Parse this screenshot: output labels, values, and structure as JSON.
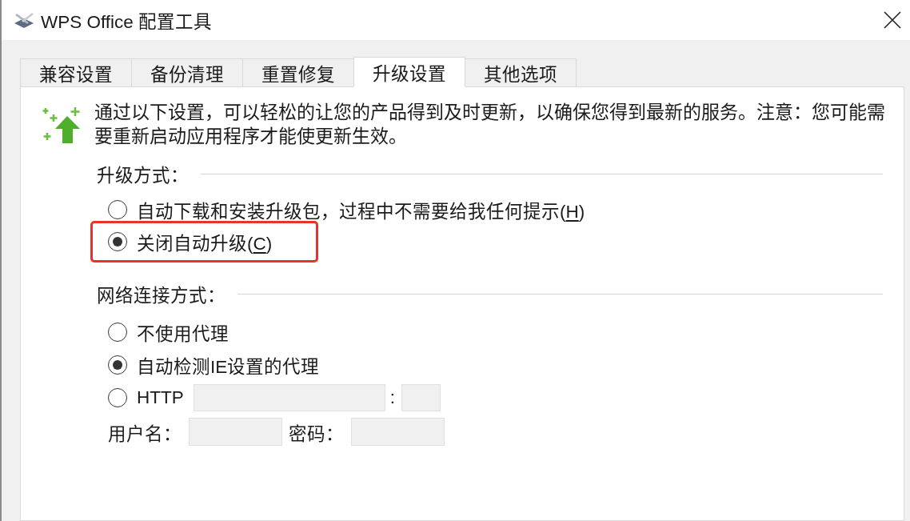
{
  "window": {
    "title": "WPS Office 配置工具"
  },
  "tabs": [
    {
      "label": "兼容设置",
      "selected": false
    },
    {
      "label": "备份清理",
      "selected": false
    },
    {
      "label": "重置修复",
      "selected": false
    },
    {
      "label": "升级设置",
      "selected": true
    },
    {
      "label": "其他选项",
      "selected": false
    }
  ],
  "intro": {
    "text": "通过以下设置，可以轻松的让您的产品得到及时更新，以确保您得到最新的服务。注意：您可能需要重新启动应用程序才能使更新生效。"
  },
  "upgrade_mode": {
    "label": "升级方式：",
    "options": [
      {
        "label_parts": [
          {
            "text": "自动下载和安装升级包，过程中不需要给我任何提示(",
            "underline": false
          },
          {
            "text": "H",
            "underline": true
          },
          {
            "text": ")",
            "underline": false
          }
        ],
        "selected": false,
        "highlighted": false
      },
      {
        "label_parts": [
          {
            "text": "关闭自动升级(",
            "underline": false
          },
          {
            "text": "C",
            "underline": true
          },
          {
            "text": ")",
            "underline": false
          }
        ],
        "selected": true,
        "highlighted": true
      }
    ]
  },
  "network": {
    "label": "网络连接方式：",
    "options": [
      {
        "kind": "plain",
        "label": "不使用代理",
        "selected": false
      },
      {
        "kind": "plain",
        "label": "自动检测IE设置的代理",
        "selected": true
      },
      {
        "kind": "http",
        "label": "HTTP",
        "selected": false,
        "host_field": {
          "disabled": true
        },
        "separator": ":",
        "port_field": {
          "disabled": true
        }
      }
    ],
    "credentials": {
      "username_label": "用户名：",
      "username_field": {
        "disabled": true
      },
      "password_label": "密码：",
      "password_field": {
        "disabled": true
      }
    }
  }
}
